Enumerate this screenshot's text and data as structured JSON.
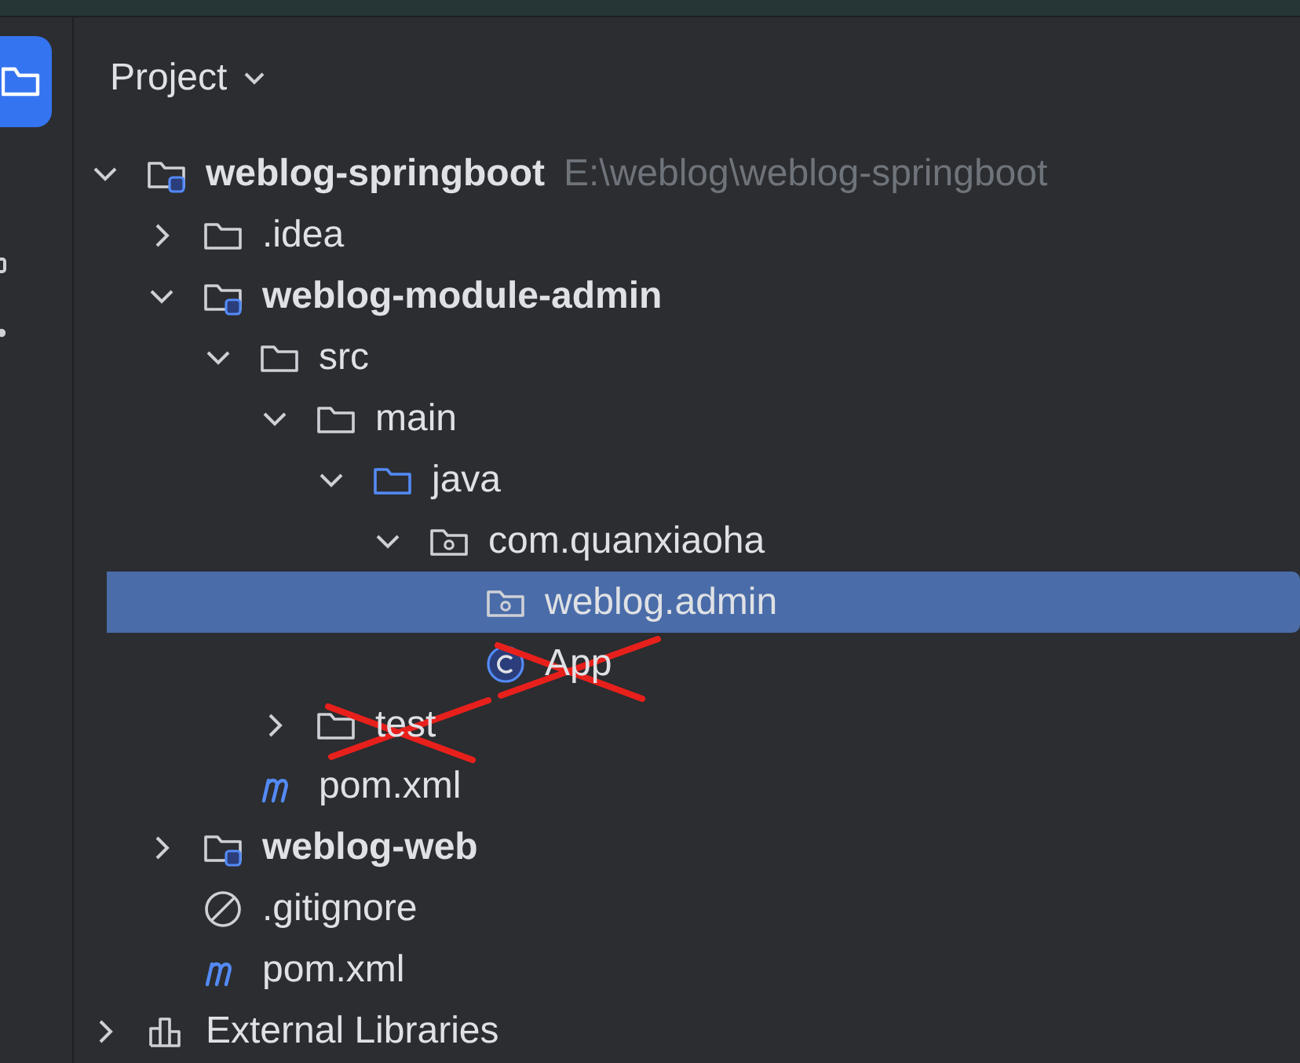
{
  "sidebar": {
    "buttons": [
      {
        "kind": "project",
        "selected": true
      },
      {
        "kind": "structure",
        "selected": false
      },
      {
        "kind": "more",
        "selected": false
      }
    ]
  },
  "panel": {
    "title": "Project"
  },
  "tree": [
    {
      "label": "weblog-springboot",
      "kind": "module",
      "hint": "E:\\weblog\\weblog-springboot",
      "expanded": true,
      "selected": false,
      "crossed_out": false,
      "children": [
        {
          "label": ".idea",
          "kind": "folder",
          "expanded": false,
          "selected": false,
          "crossed_out": false
        },
        {
          "label": "weblog-module-admin",
          "kind": "module",
          "expanded": true,
          "selected": false,
          "crossed_out": false,
          "children": [
            {
              "label": "src",
              "kind": "folder",
              "expanded": true,
              "selected": false,
              "crossed_out": false,
              "children": [
                {
                  "label": "main",
                  "kind": "folder",
                  "expanded": true,
                  "selected": false,
                  "crossed_out": false,
                  "children": [
                    {
                      "label": "java",
                      "kind": "source",
                      "expanded": true,
                      "selected": false,
                      "crossed_out": false,
                      "children": [
                        {
                          "label": "com.quanxiaoha",
                          "kind": "package",
                          "expanded": true,
                          "selected": false,
                          "crossed_out": false,
                          "children": [
                            {
                              "label": "weblog.admin",
                              "kind": "package",
                              "selected": true,
                              "crossed_out": false
                            },
                            {
                              "label": "App",
                              "kind": "class",
                              "selected": false,
                              "crossed_out": true
                            }
                          ]
                        }
                      ]
                    }
                  ]
                },
                {
                  "label": "test",
                  "kind": "folder",
                  "expanded": false,
                  "selected": false,
                  "crossed_out": true
                }
              ]
            },
            {
              "label": "pom.xml",
              "kind": "maven",
              "selected": false,
              "crossed_out": false
            }
          ]
        },
        {
          "label": "weblog-web",
          "kind": "module",
          "expanded": false,
          "selected": false,
          "crossed_out": false
        },
        {
          "label": ".gitignore",
          "kind": "ignore",
          "selected": false,
          "crossed_out": false
        },
        {
          "label": "pom.xml",
          "kind": "maven",
          "selected": false,
          "crossed_out": false
        }
      ]
    },
    {
      "label": "External Libraries",
      "kind": "library",
      "expanded": false,
      "selected": false,
      "crossed_out": false
    }
  ]
}
